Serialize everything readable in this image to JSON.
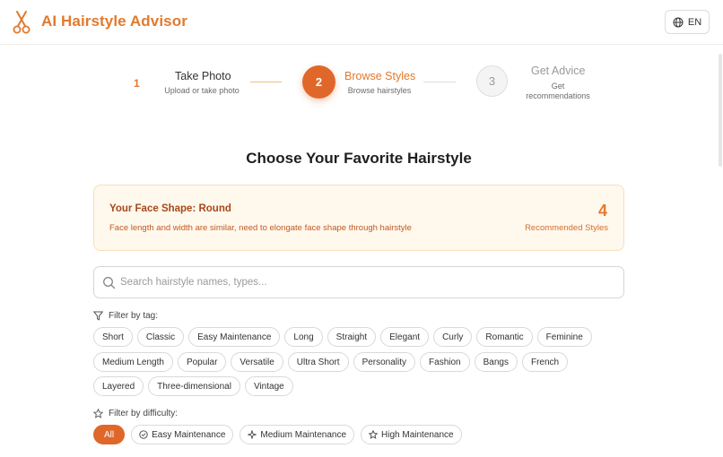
{
  "header": {
    "app_title": "AI Hairstyle Advisor",
    "logo_icon": "scissors-icon",
    "lang_icon": "globe-icon",
    "lang_label": "EN"
  },
  "stepper": {
    "steps": [
      {
        "number": "1",
        "title": "Take Photo",
        "subtitle": "Upload or take photo",
        "state": "completed"
      },
      {
        "number": "2",
        "title": "Browse Styles",
        "subtitle": "Browse hairstyles",
        "state": "active"
      },
      {
        "number": "3",
        "title": "Get Advice",
        "subtitle_line1": "Get",
        "subtitle_line2": "recommendations",
        "state": "pending"
      }
    ]
  },
  "main": {
    "heading": "Choose Your Favorite Hairstyle"
  },
  "face_card": {
    "title": "Your Face Shape: Round",
    "description": "Face length and width are similar, need to elongate face shape through hairstyle",
    "count": "4",
    "count_label": "Recommended Styles"
  },
  "search": {
    "placeholder": "Search hairstyle names, types...",
    "value": "",
    "icon": "search-icon"
  },
  "tag_filter": {
    "label": "Filter by tag:",
    "icon": "filter-icon",
    "rows": [
      [
        "Short",
        "Classic",
        "Easy Maintenance",
        "Long",
        "Straight",
        "Elegant",
        "Curly",
        "Romantic",
        "Feminine"
      ],
      [
        "Medium Length",
        "Popular",
        "Versatile",
        "Ultra Short",
        "Personality",
        "Fashion",
        "Bangs",
        "French"
      ],
      [
        "Layered",
        "Three-dimensional",
        "Vintage"
      ]
    ]
  },
  "difficulty_filter": {
    "label": "Filter by difficulty:",
    "icon": "star-icon",
    "options": [
      {
        "label": "All",
        "icon": "",
        "active": true
      },
      {
        "label": "Easy Maintenance",
        "icon": "check-circle-icon",
        "active": false
      },
      {
        "label": "Medium Maintenance",
        "icon": "sparkle-icon",
        "active": false
      },
      {
        "label": "High Maintenance",
        "icon": "star-icon",
        "active": false
      }
    ]
  },
  "colors": {
    "accent": "#e07a2f",
    "accent_strong": "#e0672a",
    "card_bg": "#fff8ec",
    "card_border": "#f6dfba"
  }
}
